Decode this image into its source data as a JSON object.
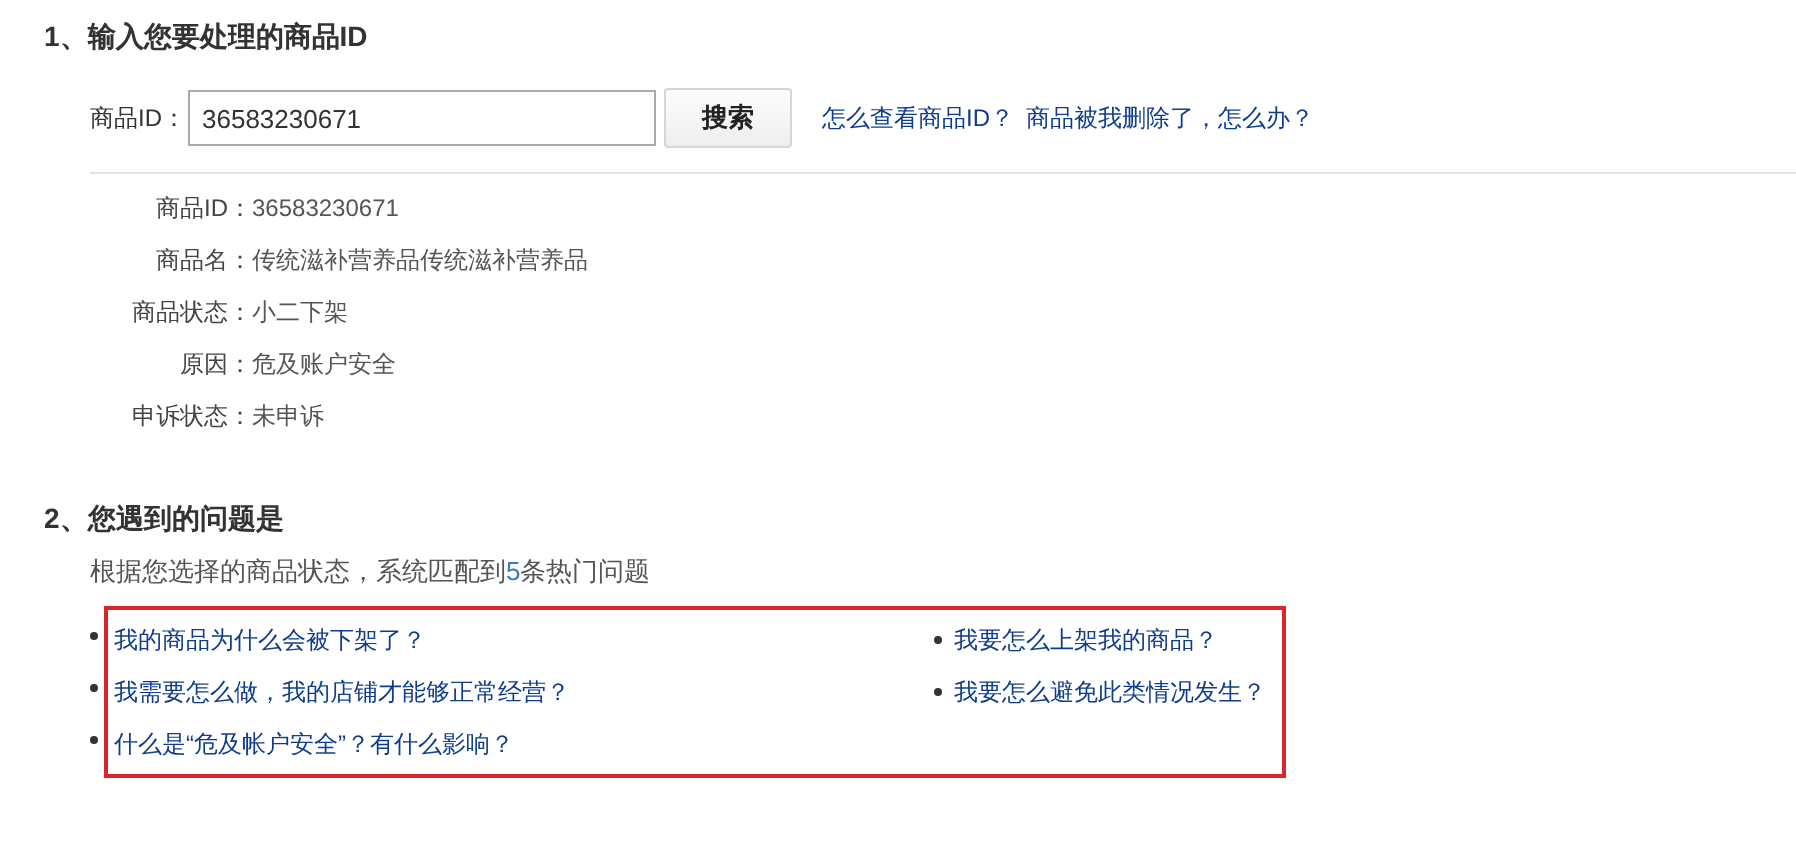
{
  "section_1": {
    "title": "1、输入您要处理的商品ID",
    "search": {
      "label": "商品ID：",
      "value": "36583230671",
      "button": "搜索",
      "links": [
        "怎么查看商品ID？",
        "商品被我删除了，怎么办？"
      ]
    },
    "details": [
      {
        "label": "商品ID：",
        "value": "36583230671"
      },
      {
        "label": "商品名：",
        "value": "传统滋补营养品传统滋补营养品"
      },
      {
        "label": "商品状态：",
        "value": "小二下架"
      },
      {
        "label": "原因：",
        "value": "危及账户安全"
      },
      {
        "label": "申诉状态：",
        "value": "未申诉"
      }
    ]
  },
  "section_2": {
    "title": "2、您遇到的问题是",
    "summary": {
      "before": "根据您选择的商品状态，系统匹配到",
      "count": "5",
      "after": "条热门问题"
    },
    "questions_left": [
      "我的商品为什么会被下架了？",
      "我需要怎么做，我的店铺才能够正常经营？",
      "什么是“危及帐户安全”？有什么影响？"
    ],
    "questions_right": [
      "我要怎么上架我的商品？",
      "我要怎么避免此类情况发生？"
    ]
  }
}
